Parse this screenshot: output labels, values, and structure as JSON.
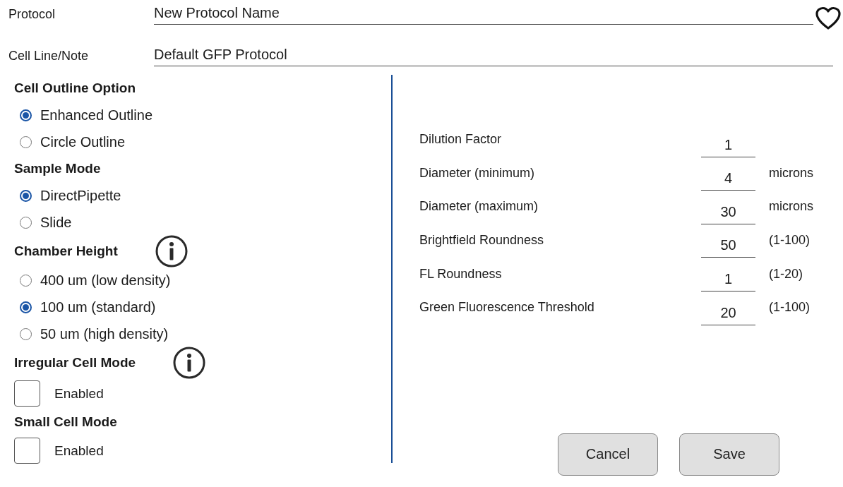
{
  "protocol": {
    "label": "Protocol",
    "value": "New Protocol Name",
    "favorite": false
  },
  "cell_line": {
    "label": "Cell Line/Note",
    "value": "Default GFP Protocol"
  },
  "sections": [
    {
      "kind": "radio",
      "title": "Cell Outline Option",
      "info": false,
      "options": [
        {
          "label": "Enhanced Outline",
          "selected": true
        },
        {
          "label": "Circle Outline",
          "selected": false
        }
      ]
    },
    {
      "kind": "radio",
      "title": "Sample Mode",
      "info": false,
      "options": [
        {
          "label": "DirectPipette",
          "selected": true
        },
        {
          "label": "Slide",
          "selected": false
        }
      ]
    },
    {
      "kind": "radio",
      "title": "Chamber Height",
      "info": true,
      "options": [
        {
          "label": "400 um (low density)",
          "selected": false
        },
        {
          "label": "100 um (standard)",
          "selected": true
        },
        {
          "label": "50 um (high density)",
          "selected": false
        }
      ]
    },
    {
      "kind": "checkbox",
      "title": "Irregular Cell Mode",
      "info": true,
      "options": [
        {
          "label": "Enabled",
          "checked": false
        }
      ]
    },
    {
      "kind": "checkbox",
      "title": "Small Cell Mode",
      "info": false,
      "options": [
        {
          "label": "Enabled",
          "checked": false
        }
      ]
    }
  ],
  "parameters": [
    {
      "label": "Dilution Factor",
      "value": "1"
    },
    {
      "label": "Diameter (minimum)",
      "value": "4",
      "unit": "microns"
    },
    {
      "label": "Diameter (maximum)",
      "value": "30",
      "unit": "microns"
    },
    {
      "label": "Brightfield Roundness",
      "value": "50",
      "unit": "(1-100)"
    },
    {
      "label": "FL Roundness",
      "value": "1",
      "unit": "(1-20)"
    },
    {
      "label": "Green Fluorescence Threshold",
      "value": "20",
      "unit": "(1-100)"
    }
  ],
  "buttons": [
    "Cancel",
    "Save"
  ]
}
